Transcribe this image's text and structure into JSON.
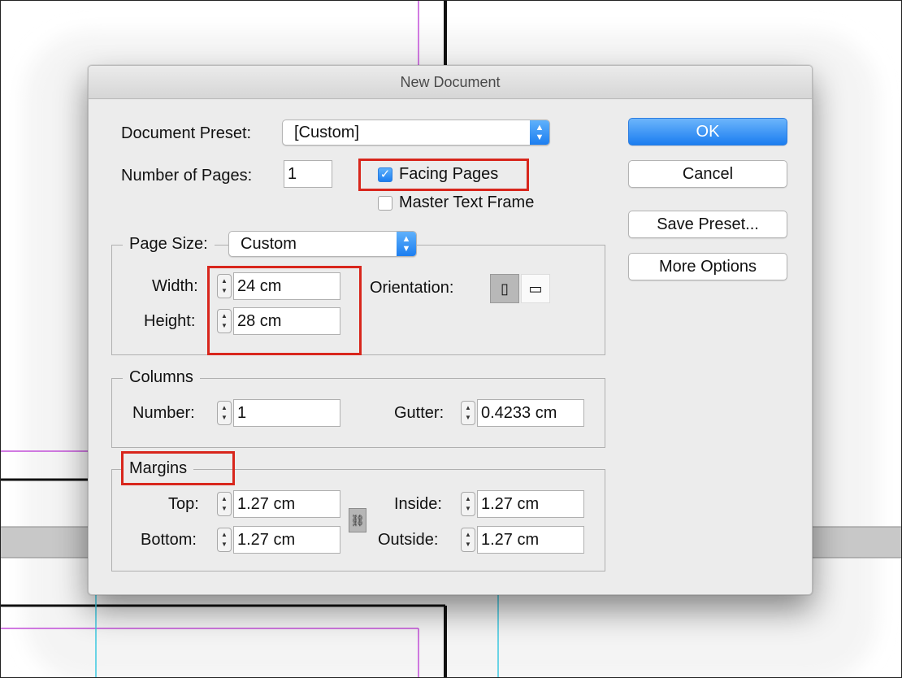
{
  "dialog": {
    "title": "New Document",
    "document_preset": {
      "label": "Document Preset:",
      "value": "[Custom]"
    },
    "number_of_pages": {
      "label": "Number of Pages:",
      "value": "1"
    },
    "facing_pages": {
      "label": "Facing Pages",
      "checked": true
    },
    "master_text_frame": {
      "label": "Master Text Frame",
      "checked": false
    },
    "page_size": {
      "group_label": "Page Size:",
      "preset": "Custom",
      "width": {
        "label": "Width:",
        "value": "24 cm"
      },
      "height": {
        "label": "Height:",
        "value": "28 cm"
      },
      "orientation_label": "Orientation:",
      "orientation_selected": "portrait"
    },
    "columns": {
      "group_label": "Columns",
      "number": {
        "label": "Number:",
        "value": "1"
      },
      "gutter": {
        "label": "Gutter:",
        "value": "0.4233 cm"
      }
    },
    "margins": {
      "group_label": "Margins",
      "top": {
        "label": "Top:",
        "value": "1.27 cm"
      },
      "bottom": {
        "label": "Bottom:",
        "value": "1.27 cm"
      },
      "inside": {
        "label": "Inside:",
        "value": "1.27 cm"
      },
      "outside": {
        "label": "Outside:",
        "value": "1.27 cm"
      },
      "linked": true
    },
    "buttons": {
      "ok": "OK",
      "cancel": "Cancel",
      "save_preset": "Save Preset...",
      "more_options": "More Options"
    }
  },
  "colors": {
    "accent_blue": "#1c7ef0",
    "highlight_red": "#d8261c",
    "guide_magenta": "#c24fd8",
    "guide_cyan": "#3cc8e0"
  }
}
